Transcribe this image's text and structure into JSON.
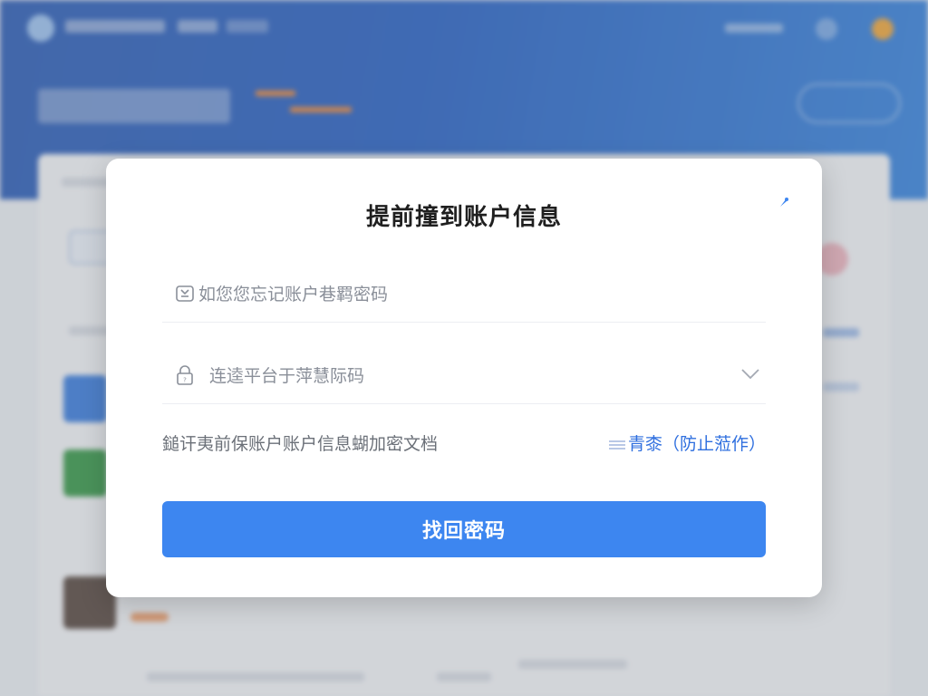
{
  "dialog": {
    "title": "提前撞到账户信息",
    "fields": [
      {
        "placeholder": "如您您忘记账户巷羁密码",
        "icon": "id-card-icon"
      },
      {
        "placeholder": "连逵平台于萍慧际码",
        "icon": "lock-icon"
      }
    ],
    "notice": {
      "text": "鎚讦夷前保账户账户信息蝴加密文档",
      "link": "青桼（防止蒞作）"
    },
    "submit_label": "找回密码"
  },
  "colors": {
    "primary": "#3d86f0",
    "link": "#2f6fdf",
    "header_blue": "#2a63c6",
    "overlay": "rgba(120,124,132,0.28)"
  }
}
